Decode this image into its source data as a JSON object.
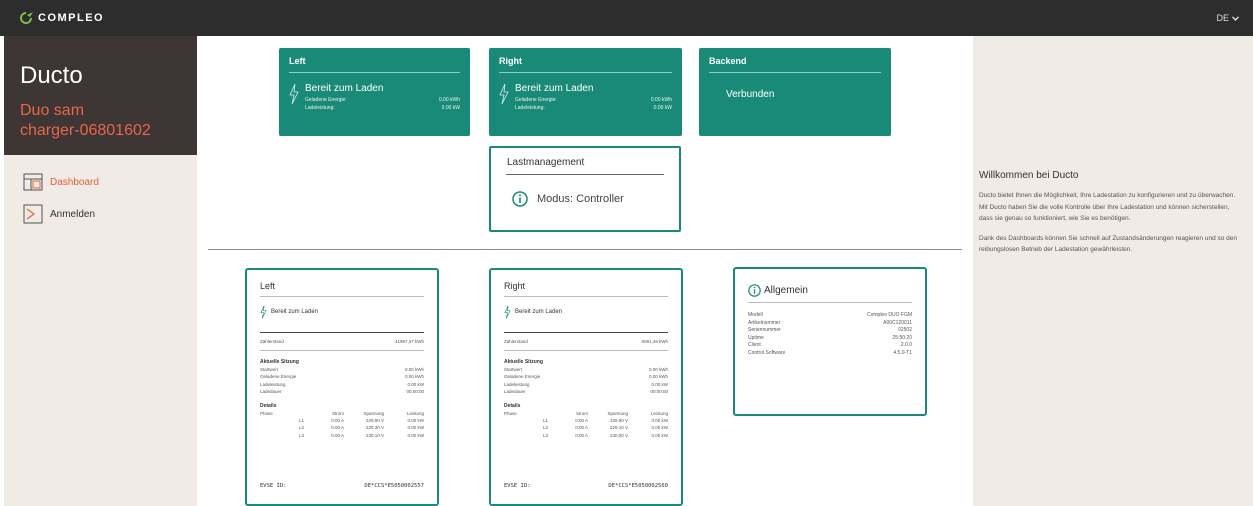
{
  "topbar": {
    "brand": "COMPLEO",
    "lang": "DE"
  },
  "sidebar": {
    "app_title": "Ducto",
    "device_line1": "Duo sam",
    "device_line2": "charger-06801602",
    "nav": [
      {
        "label": "Dashboard",
        "icon": "dashboard-icon",
        "active": true
      },
      {
        "label": "Anmelden",
        "icon": "login-icon",
        "active": false
      }
    ]
  },
  "tiles": {
    "left": {
      "title": "Left",
      "status": "Bereit zum Laden",
      "energy_label": "Geladene Energie:",
      "energy_value": "0.00 kWh",
      "power_label": "Ladeleistung:",
      "power_value": "0.00 kW"
    },
    "right": {
      "title": "Right",
      "status": "Bereit zum Laden",
      "energy_label": "Geladene Energie:",
      "energy_value": "0.00 kWh",
      "power_label": "Ladeleistung:",
      "power_value": "0.00 kW"
    },
    "backend": {
      "title": "Backend",
      "status": "Verbunden"
    }
  },
  "loadmgmt": {
    "title": "Lastmanagement",
    "mode": "Modus: Controller"
  },
  "cards": {
    "left": {
      "title": "Left",
      "status": "Bereit zum Laden",
      "counter_label": "Zählerstand",
      "counter_value": "41997,37 kWh",
      "session_title": "Aktuelle Sitzung",
      "session": [
        [
          "Startwert",
          "0.00 kWh"
        ],
        [
          "Geladene Energie",
          "0.00 kWh"
        ],
        [
          "Ladeleistung",
          "0.00 kW"
        ],
        [
          "Ladedauer",
          "00:00:00"
        ]
      ],
      "details_title": "Details",
      "details_head": [
        "Phase",
        "Strom",
        "Spannung",
        "Leistung"
      ],
      "details": [
        [
          "L1",
          "0.00 A",
          "229,90 V",
          "0.00 kW"
        ],
        [
          "L2",
          "0.00 A",
          "229,30 V",
          "0.00 kW"
        ],
        [
          "L3",
          "0.00 A",
          "230,10 V",
          "0.00 kW"
        ]
      ],
      "evse_label": "EVSE ID:",
      "evse_value": "DE*CCS*E5050002557"
    },
    "right": {
      "title": "Right",
      "status": "Bereit zum Laden",
      "counter_label": "Zählerstand",
      "counter_value": "5081,49 kWh",
      "session_title": "Aktuelle Sitzung",
      "session": [
        [
          "Startwert",
          "0.00 kWh"
        ],
        [
          "Geladene Energie",
          "0.00 kWh"
        ],
        [
          "Ladeleistung",
          "0.00 kW"
        ],
        [
          "Ladedauer",
          "00:00:00"
        ]
      ],
      "details_title": "Details",
      "details_head": [
        "Phase",
        "Strom",
        "Spannung",
        "Leistung"
      ],
      "details": [
        [
          "L1",
          "0.00 A",
          "229,90 V",
          "0.00 kW"
        ],
        [
          "L2",
          "0.00 A",
          "229,10 V",
          "0.00 kW"
        ],
        [
          "L3",
          "0.00 A",
          "230,00 V",
          "0.00 kW"
        ]
      ],
      "evse_label": "EVSE ID:",
      "evse_value": "DE*CCS*E5050002560"
    },
    "general": {
      "title": "Allgemein",
      "rows": [
        [
          "Modell",
          "Compleo DUO FGM"
        ],
        [
          "Artikelnummer",
          "A00C120011"
        ],
        [
          "Seriennummer",
          "02502"
        ],
        [
          "Uptime",
          "25:50:20"
        ],
        [
          "Client",
          "2.0.0"
        ],
        [
          "Control Software",
          "4.5.0-T1"
        ]
      ]
    }
  },
  "welcome": {
    "title": "Willkommen bei Ducto",
    "p1": "Ducto bietet Ihnen die Möglichkeit, Ihre Ladestation zu konfigurieren und zu überwachen. Mit Ducto haben Sie die volle Kontrolle über Ihre Ladestation und können sicherstellen, dass sie genau so funktioniert, wie Sie es benötigen.",
    "p2": "Dank des Dashboards können Sie schnell auf Zustandsänderungen reagieren und so den reibungslosen Betrieb der Ladestation gewährleisten."
  },
  "colors": {
    "accent": "#1a8a78",
    "highlight": "#e5603f",
    "topbar": "#2d2d2d",
    "sidebar_head": "#3d3634",
    "panel_bg": "#f0ebe4"
  }
}
